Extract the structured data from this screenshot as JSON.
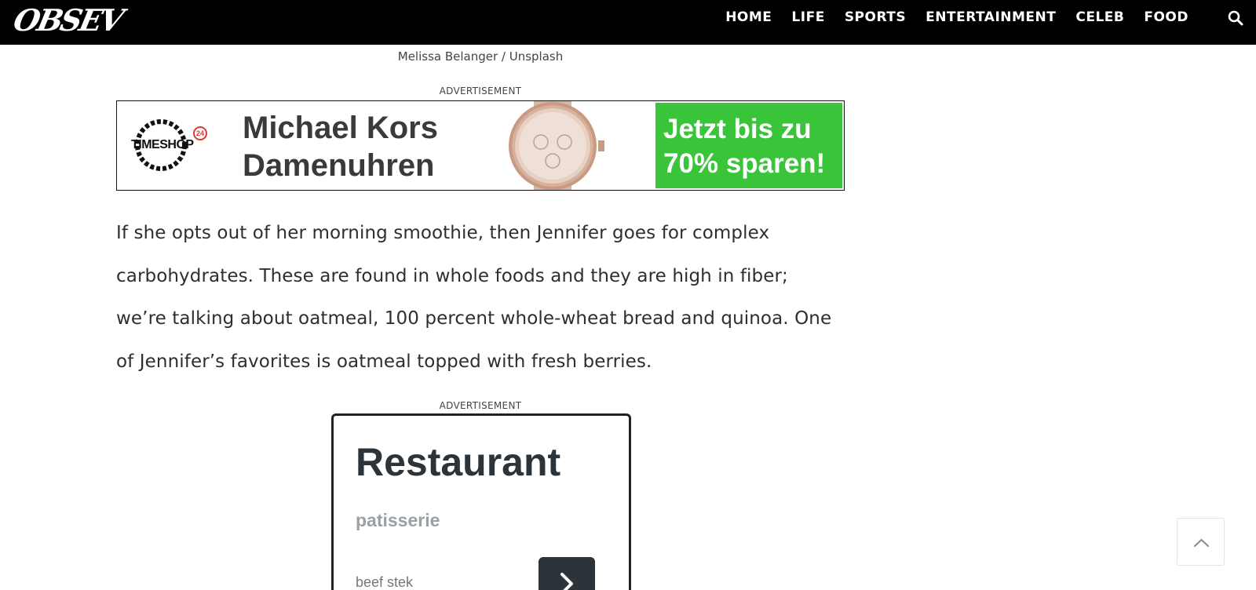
{
  "site": {
    "logo": "OBSEV"
  },
  "nav": {
    "items": [
      "HOME",
      "LIFE",
      "SPORTS",
      "ENTERTAINMENT",
      "CELEB",
      "FOOD"
    ]
  },
  "article": {
    "photo_credit": "Melissa Belanger / Unsplash",
    "ad_label": "ADVERTISEMENT",
    "paragraph": "If she opts out of her morning smoothie, then Jennifer goes for complex carbohydrates. These are found in whole foods and they are high in fiber; we’re talking about oatmeal, 100 percent whole-wheat bread and quinoa. One of Jennifer’s favorites is oatmeal topped with fresh berries."
  },
  "banner_ad": {
    "brand": "TIMESHOP",
    "badge": "24",
    "headline_line1": "Michael Kors",
    "headline_line2": "Damenuhren",
    "cta_line1": "Jetzt bis zu",
    "cta_line2": "70% sparen!",
    "cta_color": "#3ac43a"
  },
  "restaurant_ad": {
    "title": "Restaurant",
    "subtitle": "patisserie",
    "item": "beef stek"
  },
  "icons": {
    "search": "search-icon",
    "back_to_top": "chevron-up-icon",
    "next": "chevron-right-icon"
  }
}
